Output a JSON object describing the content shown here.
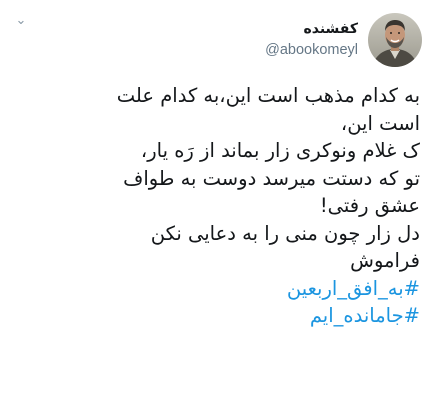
{
  "author": {
    "display_name": "کفشنده",
    "handle": "@abookomeyl",
    "avatar_icon": "profile-photo",
    "caret_icon": "chevron-down-icon",
    "caret_glyph": "⌄"
  },
  "tweet": {
    "lines": [
      "به کدام مذهب است این،به کدام علت",
      "است این،",
      "ک غلام ونوکری زار بماند از رَه یار،",
      "تو که دستت میرسد دوست به طواف",
      "عشق رفتی!",
      "دل زار چون منی را به دعایی نکن",
      "فراموش"
    ],
    "hashtags": [
      "#به_افق_اربعین",
      "#جامانده_ایم"
    ]
  },
  "colors": {
    "text": "#14171a",
    "secondary": "#657786",
    "link": "#1b95e0",
    "icon": "#8899a6"
  }
}
